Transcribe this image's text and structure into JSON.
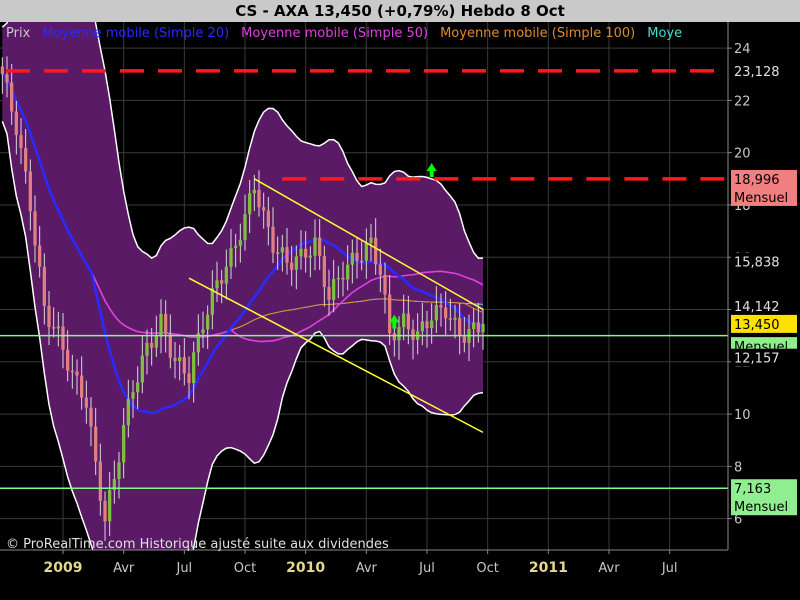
{
  "header": {
    "title": "CS - AXA     13,450 (+0,79%)     Hebdo  8 Oct"
  },
  "legend": [
    {
      "label": "Prix",
      "color": "#c8c8c8"
    },
    {
      "label": "Moyenne mobile (Simple 20)",
      "color": "#2a2aff"
    },
    {
      "label": "Moyenne mobile (Simple 50)",
      "color": "#e040e0"
    },
    {
      "label": "Moyenne mobile (Simple 100)",
      "color": "#e08a30"
    },
    {
      "label": "Moye",
      "color": "#40e0d0"
    }
  ],
  "footer": {
    "text": "© ProRealTime.com Historique ajusté suite aux dividendes"
  },
  "colors": {
    "background": "#000000",
    "grid": "#3a3a3a",
    "candle_up": "#7fbf3f",
    "candle_down": "#e08080",
    "bollinger_fill": "#5a1a66",
    "bollinger_edge": "#ffffff",
    "ma20": "#2a2aff",
    "ma50": "#e040e0",
    "ma100": "#e08a30",
    "ma200": "#40e0d0",
    "resistance": "#ff1a1a",
    "support": "#7fff7f",
    "channel": "#ffff33",
    "arrow": "#00ff00"
  },
  "chart_data": {
    "type": "candlestick",
    "ylim": [
      4.8,
      25
    ],
    "yticks": [
      6,
      8,
      10,
      12,
      14,
      16,
      18,
      20,
      22,
      24
    ],
    "xticks": [
      {
        "label": "2009",
        "year": true
      },
      {
        "label": "Avr",
        "year": false
      },
      {
        "label": "Jul",
        "year": false
      },
      {
        "label": "Oct",
        "year": false
      },
      {
        "label": "2010",
        "year": true
      },
      {
        "label": "Avr",
        "year": false
      },
      {
        "label": "Jul",
        "year": false
      },
      {
        "label": "Oct",
        "year": false
      },
      {
        "label": "2011",
        "year": true
      },
      {
        "label": "Avr",
        "year": false
      },
      {
        "label": "Jul",
        "year": false
      }
    ],
    "x_tick_index": [
      13,
      26,
      39,
      52,
      65,
      78,
      91,
      104,
      117,
      130,
      143
    ],
    "price_points": [
      [
        0,
        23.0
      ],
      [
        3,
        21.0
      ],
      [
        6,
        18.0
      ],
      [
        9,
        14.0
      ],
      [
        12,
        13.0
      ],
      [
        15,
        11.5
      ],
      [
        18,
        10.5
      ],
      [
        20,
        8.0
      ],
      [
        22,
        6.0
      ],
      [
        24,
        7.5
      ],
      [
        26,
        9.5
      ],
      [
        28,
        11.0
      ],
      [
        31,
        12.5
      ],
      [
        34,
        13.5
      ],
      [
        37,
        12.0
      ],
      [
        40,
        11.5
      ],
      [
        43,
        13.5
      ],
      [
        46,
        15.0
      ],
      [
        49,
        16.0
      ],
      [
        52,
        17.5
      ],
      [
        54,
        18.8
      ],
      [
        56,
        17.5
      ],
      [
        58,
        16.5
      ],
      [
        61,
        15.8
      ],
      [
        64,
        16.0
      ],
      [
        67,
        16.5
      ],
      [
        70,
        14.5
      ],
      [
        73,
        15.5
      ],
      [
        76,
        16.0
      ],
      [
        79,
        16.5
      ],
      [
        81,
        15.5
      ],
      [
        83,
        13.0
      ],
      [
        86,
        13.5
      ],
      [
        89,
        13.0
      ],
      [
        92,
        13.8
      ],
      [
        95,
        14.0
      ],
      [
        98,
        13.0
      ],
      [
        101,
        13.2
      ],
      [
        103,
        13.45
      ]
    ],
    "last_price": 13.45,
    "resistance_levels": [
      23.128,
      18.996
    ],
    "support_levels": [
      13.0,
      7.163
    ],
    "price_badges": [
      {
        "value": "23,128",
        "sub": "",
        "bg": "#000000",
        "fg": "#e0e0e0",
        "price": 23.128
      },
      {
        "value": "18,996",
        "sub": "Mensuel",
        "bg": "#f08080",
        "fg": "#000000",
        "price": 18.996
      },
      {
        "value": "15,838",
        "sub": "",
        "bg": "#000000",
        "fg": "#e0e0e0",
        "price": 15.838
      },
      {
        "value": "14,142",
        "sub": "",
        "bg": "#000000",
        "fg": "#e0e0e0",
        "price": 14.142
      },
      {
        "value": "13,450",
        "sub": "",
        "bg": "#ffe000",
        "fg": "#000000",
        "price": 13.45
      },
      {
        "value": "",
        "sub": "Mensuel",
        "bg": "#90ee90",
        "fg": "#000000",
        "price": 12.6
      },
      {
        "value": "12,157",
        "sub": "",
        "bg": "#000000",
        "fg": "#e0e0e0",
        "price": 12.157
      },
      {
        "value": "7,163",
        "sub": "Mensuel",
        "bg": "#90ee90",
        "fg": "#000000",
        "price": 7.163
      }
    ]
  }
}
